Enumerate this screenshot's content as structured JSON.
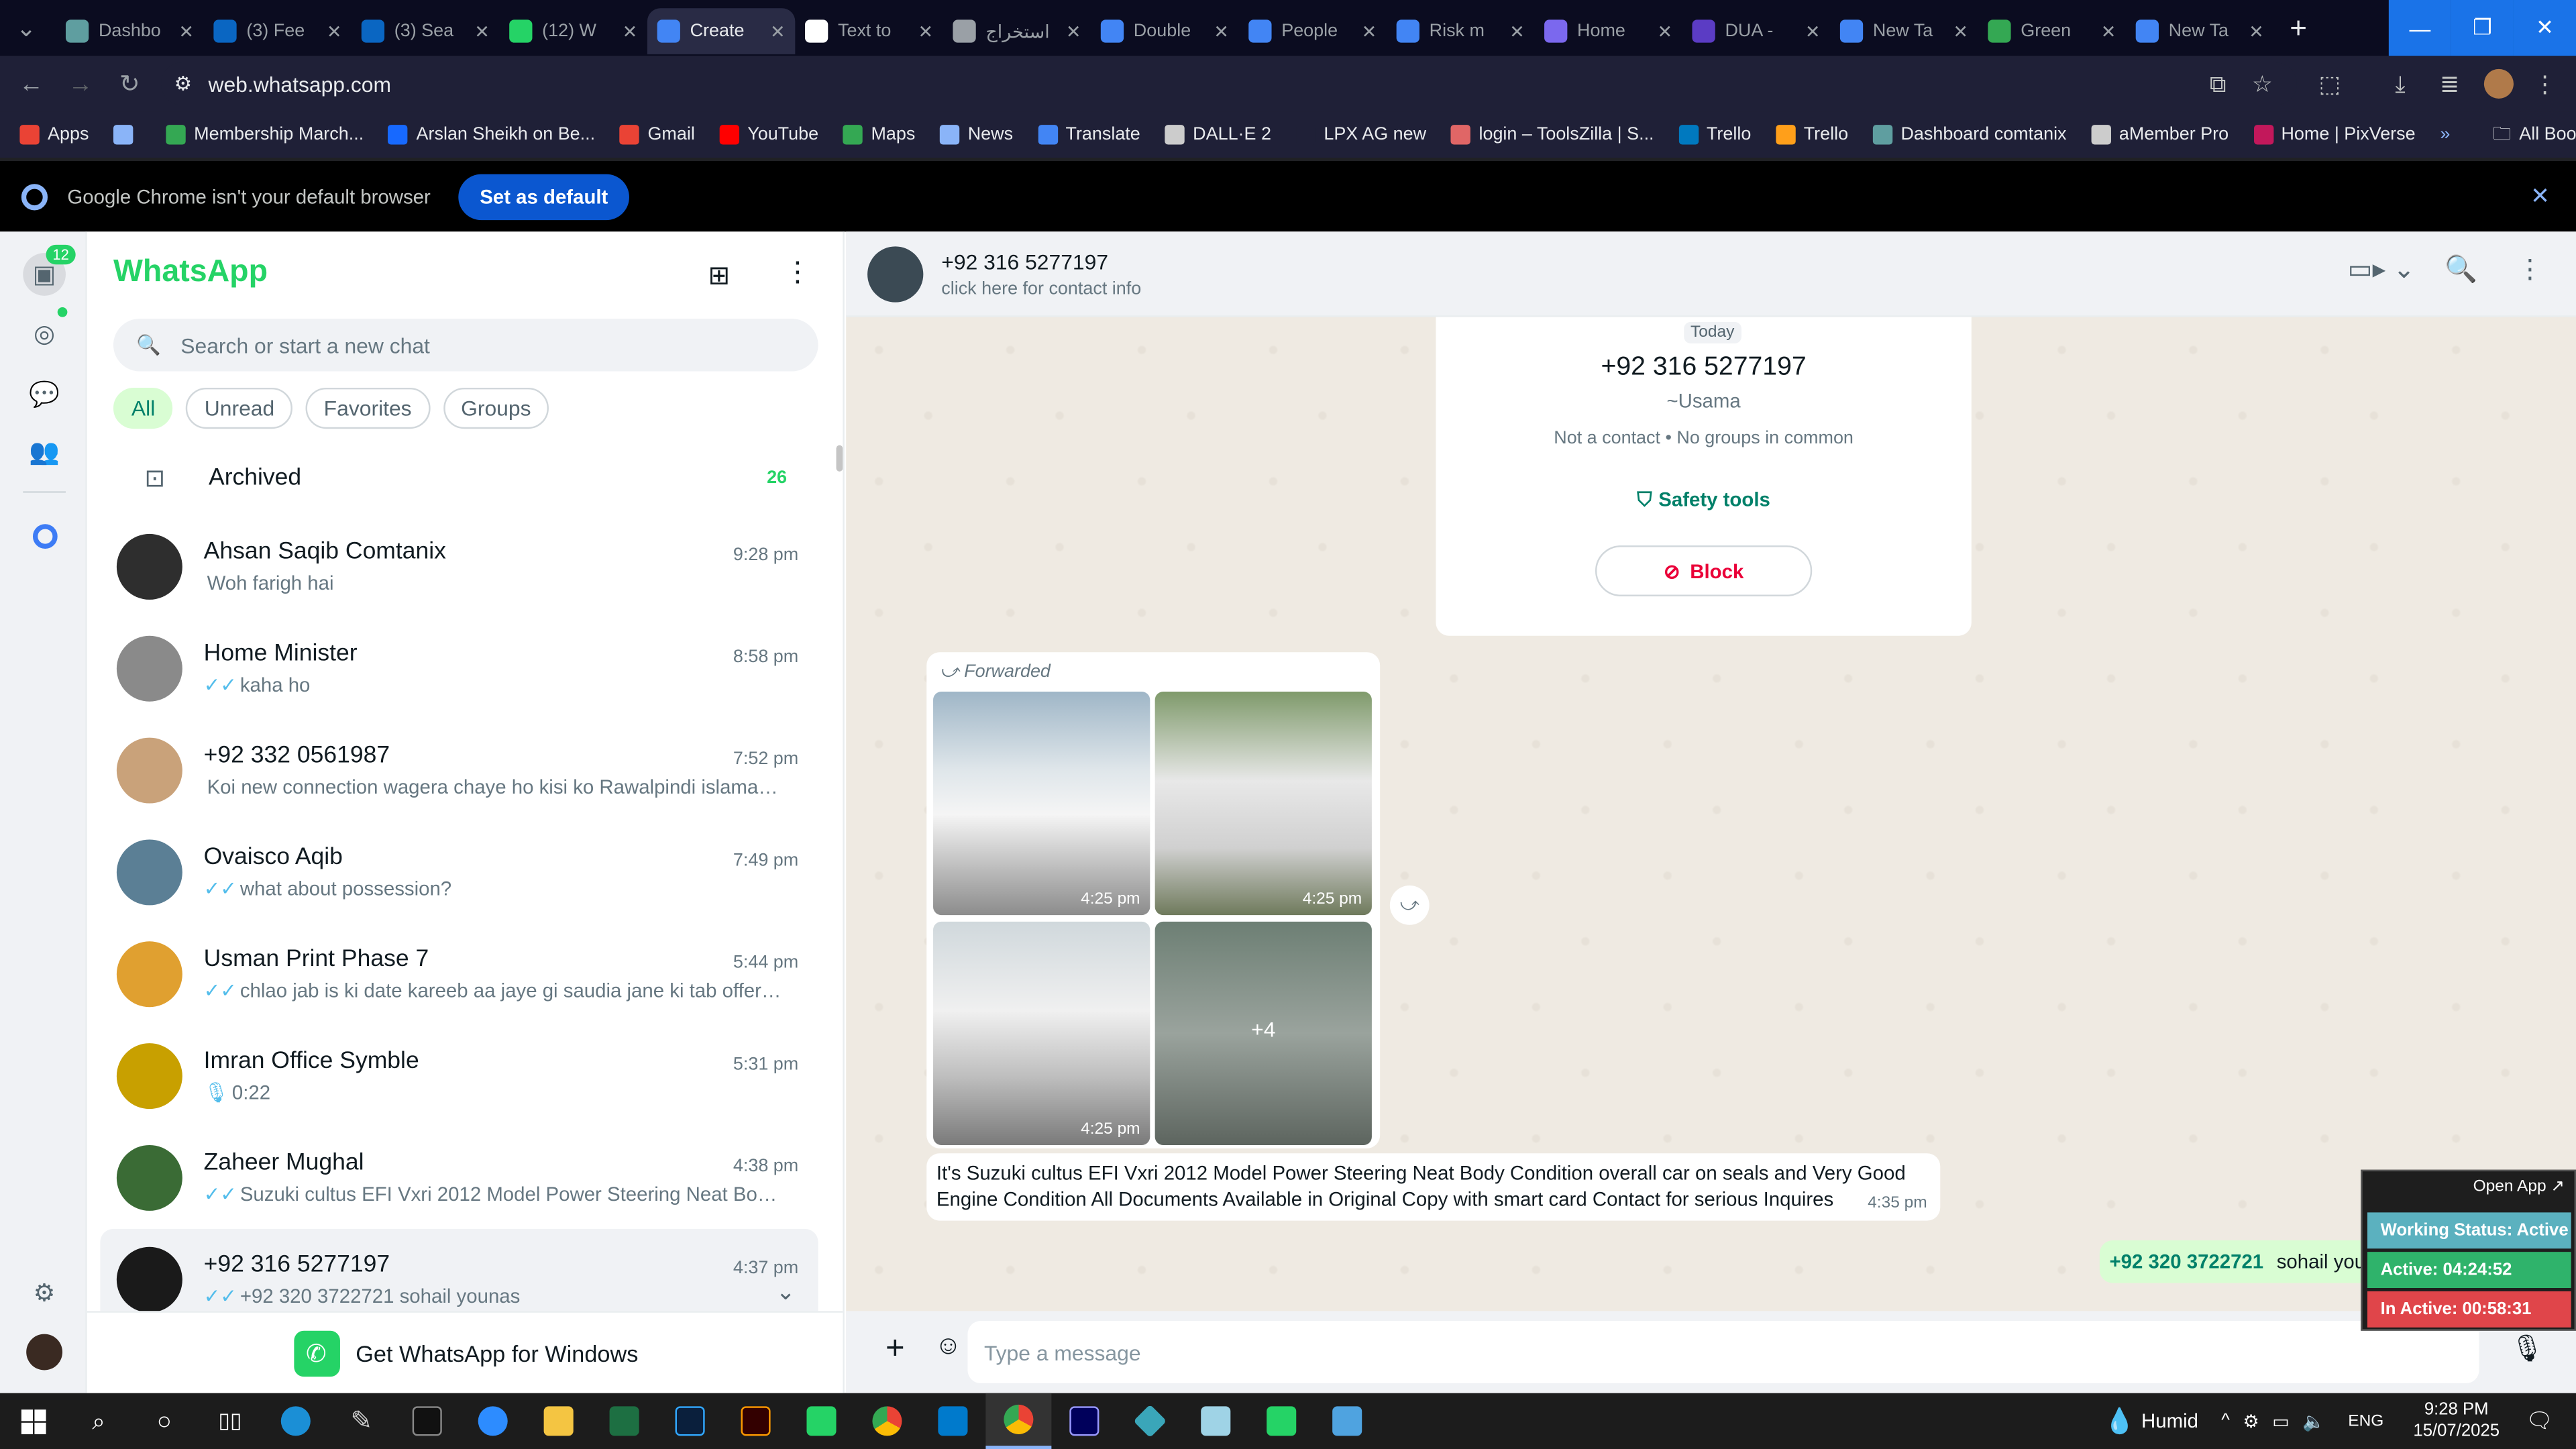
{
  "browser": {
    "tabs": [
      {
        "title": "Dashbo",
        "color": "#5f9ea0",
        "active": false
      },
      {
        "title": "(3) Fee",
        "color": "#0a66c2",
        "active": false
      },
      {
        "title": "(3) Sea",
        "color": "#0a66c2",
        "active": false
      },
      {
        "title": "(12) W",
        "color": "#25d366",
        "active": false
      },
      {
        "title": "Create",
        "color": "#4285f4",
        "active": true
      },
      {
        "title": "Text to",
        "color": "#ffffff",
        "active": false
      },
      {
        "title": "استخراج",
        "color": "#9aa0a6",
        "active": false
      },
      {
        "title": "Double",
        "color": "#4285f4",
        "active": false
      },
      {
        "title": "People",
        "color": "#4285f4",
        "active": false
      },
      {
        "title": "Risk m",
        "color": "#4285f4",
        "active": false
      },
      {
        "title": "Home",
        "color": "#7b68ee",
        "active": false
      },
      {
        "title": "DUA -",
        "color": "#5b3cc4",
        "active": false
      },
      {
        "title": "New Ta",
        "color": "#4285f4",
        "active": false
      },
      {
        "title": "Green",
        "color": "#34a853",
        "active": false
      },
      {
        "title": "New Ta",
        "color": "#4285f4",
        "active": false
      }
    ],
    "url": "web.whatsapp.com",
    "bookmarks": [
      {
        "label": "Apps",
        "color": "#ea4335"
      },
      {
        "label": "",
        "color": "#8ab4f8"
      },
      {
        "label": "Membership March...",
        "color": "#34a853"
      },
      {
        "label": "Arslan Sheikh on Be...",
        "color": "#1769ff"
      },
      {
        "label": "Gmail",
        "color": "#ea4335"
      },
      {
        "label": "YouTube",
        "color": "#ff0000"
      },
      {
        "label": "Maps",
        "color": "#34a853"
      },
      {
        "label": "News",
        "color": "#8ab4f8"
      },
      {
        "label": "Translate",
        "color": "#4285f4"
      },
      {
        "label": "DALL·E 2",
        "color": "#cccccc"
      },
      {
        "label": "LPX AG new",
        "color": "#1f2037"
      },
      {
        "label": "login – ToolsZilla | S...",
        "color": "#e06666"
      },
      {
        "label": "Trello",
        "color": "#0079bf"
      },
      {
        "label": "Trello",
        "color": "#ff9f1a"
      },
      {
        "label": "Dashboard comtanix",
        "color": "#5f9ea0"
      },
      {
        "label": "aMember Pro",
        "color": "#cccccc"
      },
      {
        "label": "Home | PixVerse",
        "color": "#c2185b"
      }
    ],
    "all_bookmarks": "All Bookmarks",
    "infobar": {
      "message": "Google Chrome isn't your default browser",
      "button": "Set as default"
    }
  },
  "whatsapp": {
    "title": "WhatsApp",
    "unread_badge": "12",
    "search_placeholder": "Search or start a new chat",
    "chips": [
      "All",
      "Unread",
      "Favorites",
      "Groups"
    ],
    "archived": {
      "label": "Archived",
      "count": "26"
    },
    "chats": [
      {
        "name": "Ahsan Saqib Comtanix",
        "message": "Woh farigh hai",
        "time": "9:28 pm",
        "tick": "",
        "avatar": "#2e2e2e"
      },
      {
        "name": "Home Minister",
        "message": "kaha ho",
        "time": "8:58 pm",
        "tick": "✓✓",
        "avatar": "#8a8a8a"
      },
      {
        "name": "+92 332 0561987",
        "message": "Koi new connection wagera chaye ho kisi ko Rawalpindi islamabad ...",
        "time": "7:52 pm",
        "tick": "",
        "avatar": "#c9a27a"
      },
      {
        "name": "Ovaisco Aqib",
        "message": "what about possession?",
        "time": "7:49 pm",
        "tick": "✓✓",
        "avatar": "#5b7f95"
      },
      {
        "name": "Usman Print Phase 7",
        "message": "chlao jab is ki date kareeb aa jaye gi  saudia jane ki tab offer de d...",
        "time": "5:44 pm",
        "tick": "✓✓",
        "avatar": "#e0a030"
      },
      {
        "name": "Imran Office Symble",
        "message": "0:22",
        "time": "5:31 pm",
        "tick": "🎙",
        "avatar": "#c8a000"
      },
      {
        "name": "Zaheer Mughal",
        "message": "Suzuki cultus EFI Vxri 2012 Model Power Steering Neat Body Con...",
        "time": "4:38 pm",
        "tick": "✓✓",
        "avatar": "#3a6b35"
      },
      {
        "name": "+92 316 5277197",
        "message": "+92 320 3722721  sohail younas",
        "time": "4:37 pm",
        "tick": "✓✓",
        "avatar": "#1a1a1a"
      }
    ],
    "get_windows": "Get WhatsApp for Windows",
    "chat": {
      "name": "+92 316 5277197",
      "subtitle": "click here for contact info",
      "today": "Today",
      "card_number": "+92 316 5277197",
      "card_alias": "~Usama",
      "card_info": "Not a contact • No groups in common",
      "safety": "Safety tools",
      "block": "Block",
      "forwarded": "Forwarded",
      "img_time": "4:25 pm",
      "more_count": "+4",
      "text": "It's Suzuki cultus EFI Vxri 2012 Model Power Steering Neat Body Condition overall car on seals and Very Good Engine Condition All Documents Available in Original Copy with smart card Contact for serious Inquires",
      "text_time": "4:35 pm",
      "out_number": "+92 320 3722721",
      "out_name": "sohail younas",
      "composer_placeholder": "Type a message"
    }
  },
  "overlay": {
    "open_app": "Open App ↗",
    "working": "Working Status: Active",
    "active": "Active: 04:24:52",
    "inactive": "In Active: 00:58:31"
  },
  "taskbar": {
    "weather": "Humid",
    "lang": "ENG",
    "time": "9:28 PM",
    "date": "15/07/2025"
  }
}
